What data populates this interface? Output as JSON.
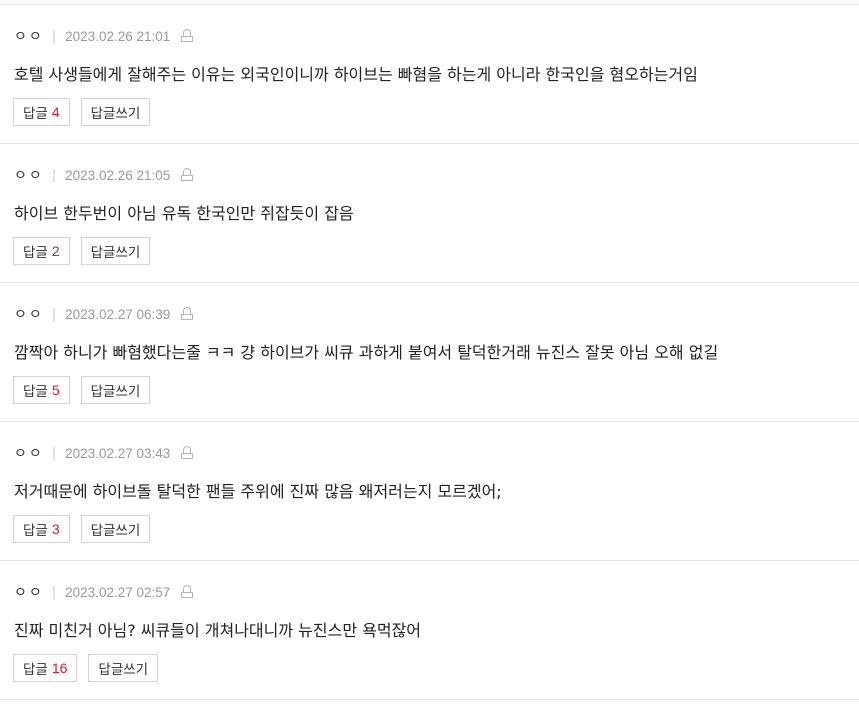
{
  "comments": [
    {
      "author": "ㅇㅇ",
      "date": "2023.02.26 21:01",
      "text": "호텔 사생들에게 잘해주는 이유는 외국인이니까 하이브는 빠혐을 하는게 아니라 한국인을 혐오하는거임",
      "reply_label": "답글",
      "reply_count": "4",
      "write_reply_label": "답글쓰기"
    },
    {
      "author": "ㅇㅇ",
      "date": "2023.02.26 21:05",
      "text": "하이브 한두번이 아님 유독 한국인만 쥐잡듯이 잡음",
      "reply_label": "답글",
      "reply_count": "2",
      "write_reply_label": "답글쓰기"
    },
    {
      "author": "ㅇㅇ",
      "date": "2023.02.27 06:39",
      "text": "깜짝아 하니가 빠혐했다는줄 ㅋㅋ 걍 하이브가 씨큐 과하게 붙여서 탈덕한거래 뉴진스 잘못 아님 오해 없길",
      "reply_label": "답글",
      "reply_count": "5",
      "write_reply_label": "답글쓰기"
    },
    {
      "author": "ㅇㅇ",
      "date": "2023.02.27 03:43",
      "text": "저거때문에 하이브돌 탈덕한 팬들 주위에 진짜 많음 왜저러는지 모르겠어;",
      "reply_label": "답글",
      "reply_count": "3",
      "write_reply_label": "답글쓰기"
    },
    {
      "author": "ㅇㅇ",
      "date": "2023.02.27 02:57",
      "text": "진짜 미친거 아님? 씨큐들이 개쳐나대니까 뉴진스만 욕먹잖어",
      "reply_label": "답글",
      "reply_count": "16",
      "write_reply_label": "답글쓰기"
    }
  ],
  "icons": {
    "lock": "lock-icon"
  },
  "colors": {
    "reply_count": "#d21f1f",
    "divider": "#e3e3e3",
    "meta": "#999999"
  }
}
